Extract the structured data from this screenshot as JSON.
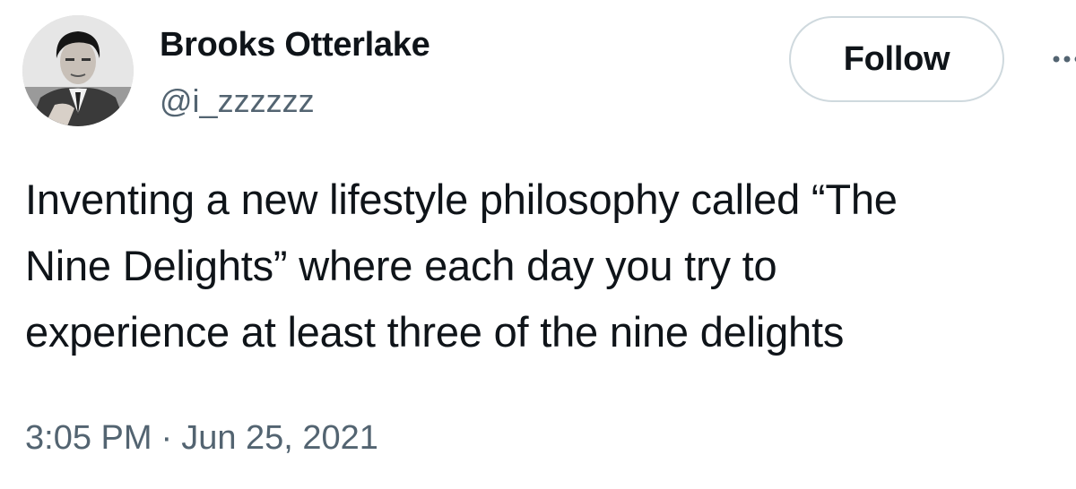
{
  "author": {
    "name": "Brooks Otterlake",
    "handle": "@i_zzzzzz",
    "avatar_icon": "profile-photo"
  },
  "actions": {
    "follow_label": "Follow",
    "more_icon": "more-options-icon"
  },
  "tweet": {
    "lines": [
      "Inventing a new lifestyle philosophy called “The",
      "Nine Delights” where each day you try to",
      "experience at least three of the nine delights"
    ]
  },
  "meta": {
    "time": "3:05 PM",
    "separator": "·",
    "date": "Jun 25, 2021"
  },
  "colors": {
    "text": "#0f1419",
    "secondary": "#536471",
    "border": "#cfd9de"
  }
}
